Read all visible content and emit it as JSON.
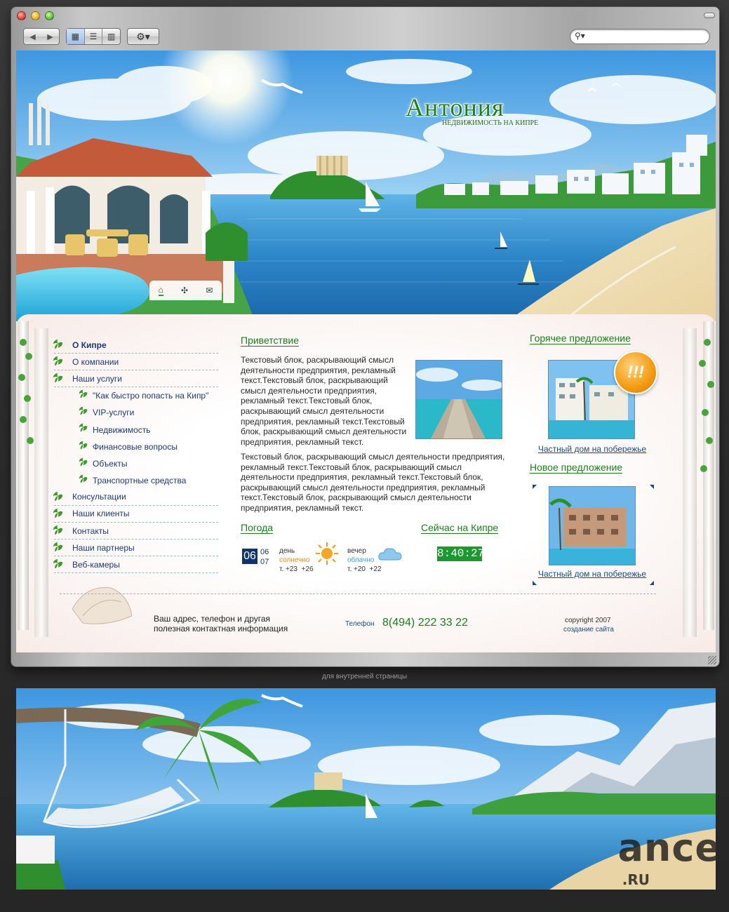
{
  "browser": {
    "search_value": ""
  },
  "site": {
    "logo_title": "Антония",
    "logo_subtitle": "НЕДВИЖИМОСТЬ НА КИПРЕ"
  },
  "menu": [
    {
      "label": "О Кипре",
      "bold": true,
      "sub": false
    },
    {
      "label": "О компании",
      "bold": false,
      "sub": false
    },
    {
      "label": "Наши услуги",
      "bold": false,
      "sub": false
    },
    {
      "label": "\"Как быстро попасть на Кипр\"",
      "bold": false,
      "sub": true
    },
    {
      "label": "VIP-услуги",
      "bold": false,
      "sub": true
    },
    {
      "label": "Недвижимость",
      "bold": false,
      "sub": true
    },
    {
      "label": "Финансовые вопросы",
      "bold": false,
      "sub": true
    },
    {
      "label": "Объекты",
      "bold": false,
      "sub": true
    },
    {
      "label": "Транспортные средства",
      "bold": false,
      "sub": true
    },
    {
      "label": "Консультации",
      "bold": false,
      "sub": false
    },
    {
      "label": "Наши клиенты",
      "bold": false,
      "sub": false
    },
    {
      "label": "Контакты",
      "bold": false,
      "sub": false
    },
    {
      "label": "Наши партнеры",
      "bold": false,
      "sub": false
    },
    {
      "label": "Веб-камеры",
      "bold": false,
      "sub": false
    }
  ],
  "welcome": {
    "title": "Приветствие",
    "para1": "Текстовый блок, раскрывающий смысл деятельности предприятия, рекламный текст.Текстовый блок, раскрывающий смысл деятельности предприятия, рекламный текст.Текстовый блок, раскрывающий смысл деятельности предприятия, рекламный текст.Текстовый блок, раскрывающий смысл деятельности предприятия, рекламный текст.",
    "para2": "Текстовый блок, раскрывающий смысл деятельности предприятия, рекламный текст.Текстовый блок, раскрывающий смысл деятельности предприятия, рекламный текст.Текстовый блок, раскрывающий смысл деятельности предприятия, рекламный текст.Текстовый блок, раскрывающий смысл деятельности предприятия, рекламный текст."
  },
  "weather": {
    "title": "Погода",
    "day": "06",
    "date_top": "06",
    "date_bottom": "07",
    "day_label": "день",
    "day_cond": "солнечно",
    "day_temp": "т. +23  +26",
    "eve_label": "вечер",
    "eve_cond": "облачно",
    "eve_temp": "т. +20  +22"
  },
  "now": {
    "title": "Сейчас на Кипре",
    "time": "8:40:27"
  },
  "hot": {
    "title": "Горячее предложение",
    "badge": "!!!",
    "caption": "Частный дом на побережье"
  },
  "new_offer": {
    "title": "Новое предложение",
    "caption": "Частный дом на побережье"
  },
  "footer": {
    "address_line1": "Ваш адрес, телефон и другая",
    "address_line2": "полезная контактная информация",
    "phone_label": "Телефон",
    "phone": "8(494) 222 33 22",
    "copyright": "copyright 2007",
    "credit": "создание сайта"
  },
  "below": {
    "caption": "для внутренней страницы",
    "watermark": "ance",
    "watermark_sub": ".RU"
  },
  "colors": {
    "accent_green": "#1c7d1c",
    "link_blue": "#1d4a80",
    "sky": "#5aa8e6",
    "sea": "#2f86c8"
  }
}
